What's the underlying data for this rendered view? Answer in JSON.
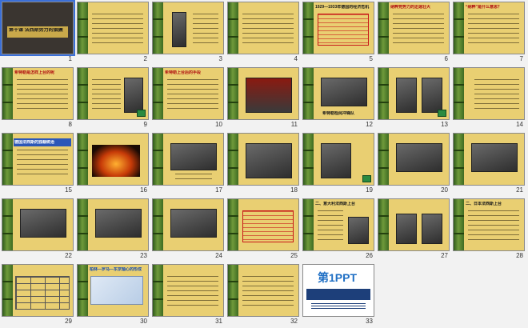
{
  "slides": [
    {
      "n": "1",
      "title": "第十课 法西斯势力的猖獗"
    },
    {
      "n": "2",
      "title": ""
    },
    {
      "n": "3",
      "title": ""
    },
    {
      "n": "4",
      "title": ""
    },
    {
      "n": "5",
      "title": "1929—1933年德国的经济危机"
    },
    {
      "n": "6",
      "title": "纳粹党势力的迅速壮大"
    },
    {
      "n": "7",
      "title": "“纳粹”是什么意思？"
    },
    {
      "n": "8",
      "title": "希特勒是怎样上台的呢"
    },
    {
      "n": "9",
      "title": ""
    },
    {
      "n": "10",
      "title": "希特勒上台后的手段"
    },
    {
      "n": "11",
      "title": ""
    },
    {
      "n": "12",
      "title": "希特勒检阅冲锋队"
    },
    {
      "n": "13",
      "title": ""
    },
    {
      "n": "14",
      "title": ""
    },
    {
      "n": "15",
      "title": "德国法西斯的独裁统治"
    },
    {
      "n": "16",
      "title": ""
    },
    {
      "n": "17",
      "title": ""
    },
    {
      "n": "18",
      "title": ""
    },
    {
      "n": "19",
      "title": ""
    },
    {
      "n": "20",
      "title": ""
    },
    {
      "n": "21",
      "title": ""
    },
    {
      "n": "22",
      "title": ""
    },
    {
      "n": "23",
      "title": ""
    },
    {
      "n": "24",
      "title": ""
    },
    {
      "n": "25",
      "title": ""
    },
    {
      "n": "26",
      "title": "二、意大利法西斯上台"
    },
    {
      "n": "27",
      "title": ""
    },
    {
      "n": "28",
      "title": "二、日本法西斯上台"
    },
    {
      "n": "29",
      "title": ""
    },
    {
      "n": "30",
      "title": "柏林—罗马—东京轴心的形成"
    },
    {
      "n": "31",
      "title": ""
    },
    {
      "n": "32",
      "title": ""
    },
    {
      "n": "33",
      "title": "第1PPT"
    }
  ]
}
